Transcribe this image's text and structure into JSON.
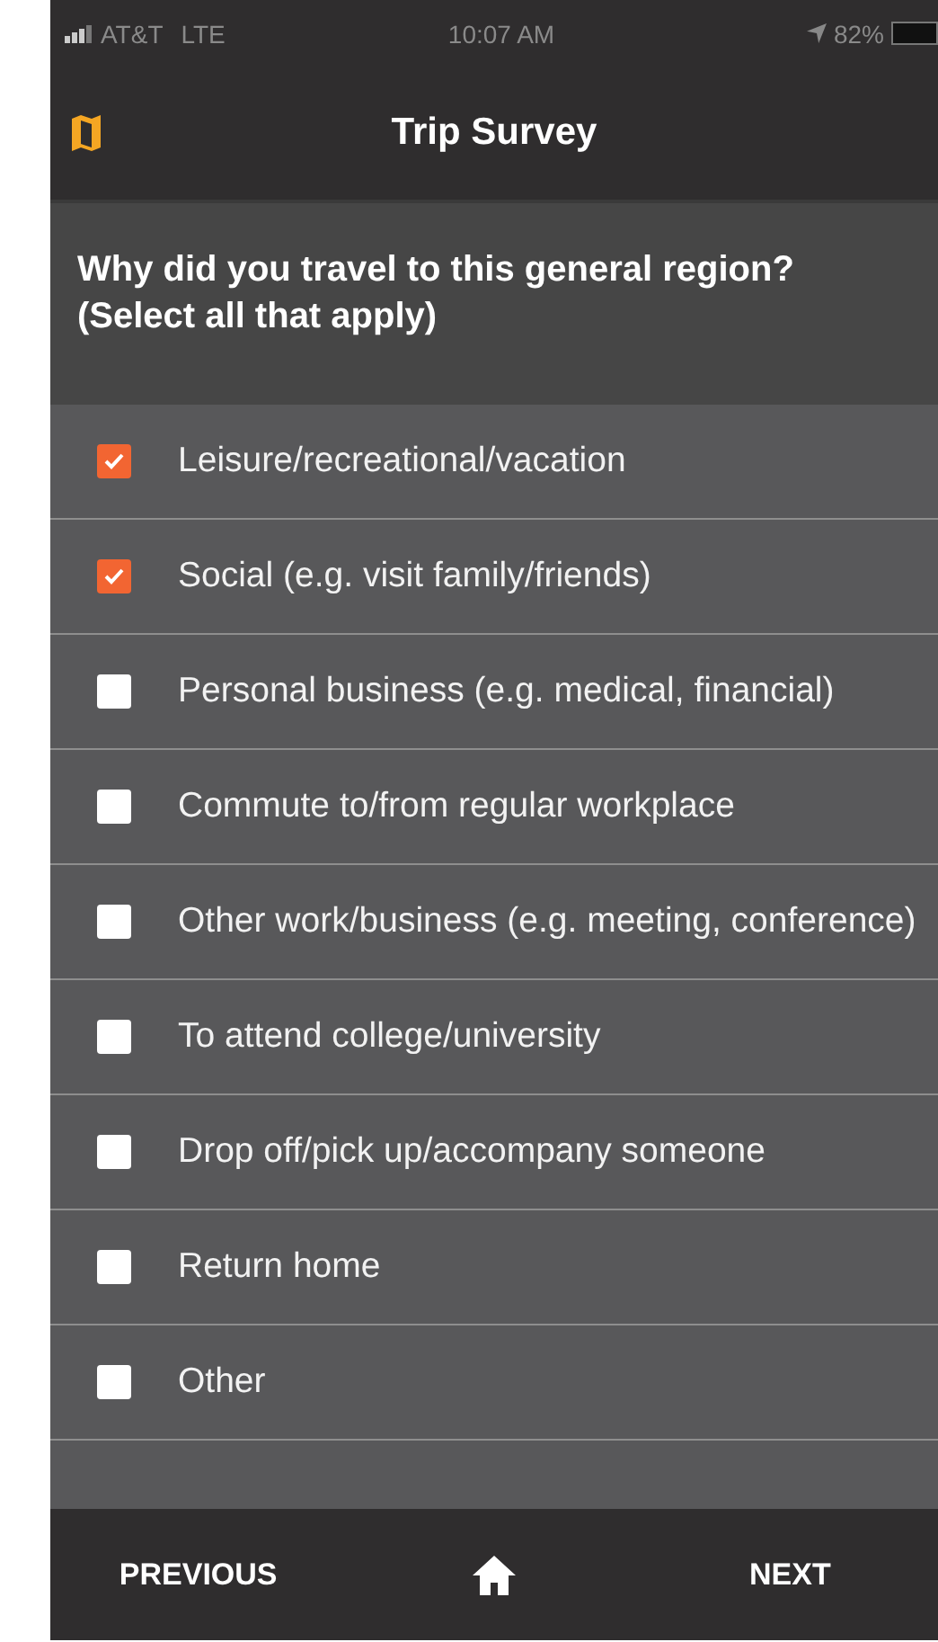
{
  "status_bar": {
    "carrier": "AT&T",
    "network": "LTE",
    "time": "10:07 AM",
    "battery": "82%"
  },
  "header": {
    "title": "Trip Survey"
  },
  "question": "Why did you travel to this general region? (Select all that apply)",
  "options": [
    {
      "label": "Leisure/recreational/vacation",
      "checked": true
    },
    {
      "label": "Social (e.g. visit family/friends)",
      "checked": true
    },
    {
      "label": "Personal business (e.g. medical, financial)",
      "checked": false
    },
    {
      "label": "Commute to/from regular workplace",
      "checked": false
    },
    {
      "label": "Other work/business (e.g. meeting, conference)",
      "checked": false
    },
    {
      "label": "To attend college/university",
      "checked": false
    },
    {
      "label": "Drop off/pick up/accompany someone",
      "checked": false
    },
    {
      "label": "Return home",
      "checked": false
    },
    {
      "label": "Other",
      "checked": false
    }
  ],
  "nav": {
    "previous": "PREVIOUS",
    "next": "NEXT"
  }
}
